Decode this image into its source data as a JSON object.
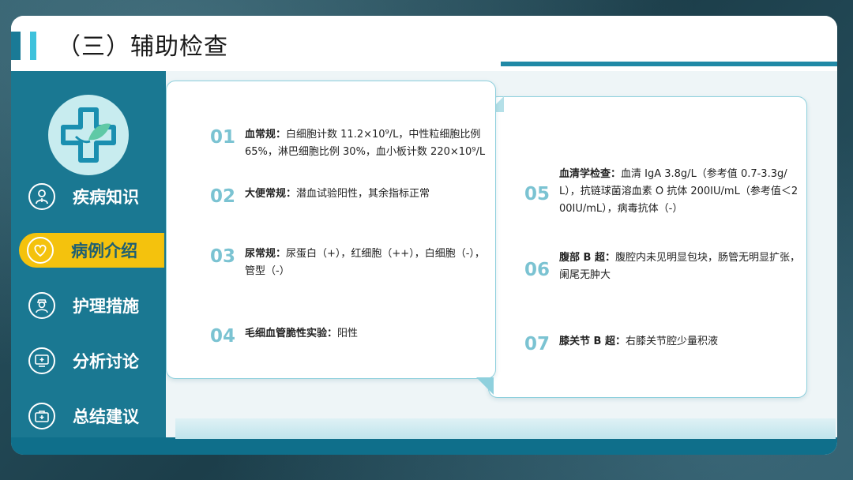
{
  "title": "（三）辅助检查",
  "sidebar": {
    "items": [
      {
        "label": "疾病知识",
        "icon": "doctor-person-icon",
        "active": false
      },
      {
        "label": "病例介绍",
        "icon": "heart-hands-icon",
        "active": true
      },
      {
        "label": "护理措施",
        "icon": "nurse-icon",
        "active": false
      },
      {
        "label": "分析讨论",
        "icon": "medical-monitor-icon",
        "active": false
      },
      {
        "label": "总结建议",
        "icon": "first-aid-kit-icon",
        "active": false
      }
    ]
  },
  "items": [
    {
      "num": "01",
      "label": "血常规：",
      "text": "白细胞计数 11.2×10⁹/L，中性粒细胞比例 65%，淋巴细胞比例 30%，血小板计数 220×10⁹/L"
    },
    {
      "num": "02",
      "label": "大便常规：",
      "text": "潜血试验阳性，其余指标正常"
    },
    {
      "num": "03",
      "label": "尿常规：",
      "text": "尿蛋白（+），红细胞（++），白细胞（-），管型（-）"
    },
    {
      "num": "04",
      "label": "毛细血管脆性实验：",
      "text": "阳性"
    },
    {
      "num": "05",
      "label": "血清学检查：",
      "text": "血清 IgA 3.8g/L（参考值 0.7-3.3g/L），抗链球菌溶血素 O 抗体 200IU/mL（参考值＜200IU/mL），病毒抗体（-）"
    },
    {
      "num": "06",
      "label": "腹部 B 超：",
      "text": "腹腔内未见明显包块，肠管无明显扩张，阑尾无肿大"
    },
    {
      "num": "07",
      "label": "膝关节 B 超：",
      "text": "右膝关节腔少量积液"
    }
  ],
  "colors": {
    "primary": "#1a7892",
    "accent": "#f4c20d",
    "number": "#7bc3d2"
  }
}
